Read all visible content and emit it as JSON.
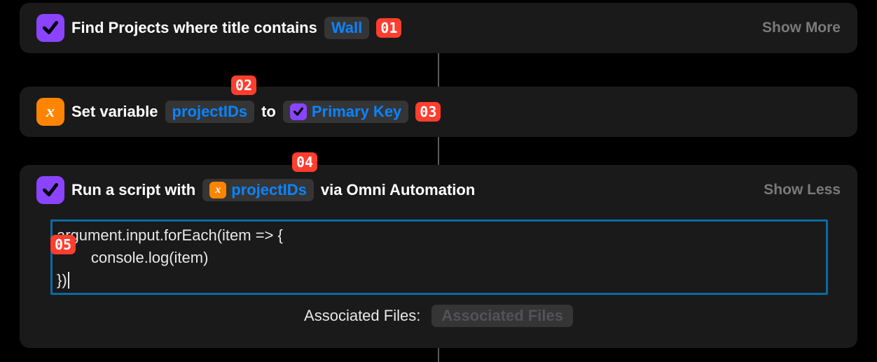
{
  "actions": {
    "find": {
      "text_before": "Find Projects where title contains",
      "search_token": "Wall",
      "show_more": "Show More"
    },
    "setvar": {
      "text_before": "Set variable",
      "var_token": "projectIDs",
      "text_mid": "to",
      "value_token": "Primary Key"
    },
    "script": {
      "text_before": "Run a script with",
      "var_token": "projectIDs",
      "text_after": "via Omni Automation",
      "show_less": "Show Less",
      "code_line1": "argument.input.forEach(item => {",
      "code_line2": "        console.log(item)",
      "code_line3": "})",
      "assoc_label": "Associated Files:",
      "assoc_placeholder": "Associated Files"
    }
  },
  "callouts": {
    "c1": "01",
    "c2": "02",
    "c3": "03",
    "c4": "04",
    "c5": "05"
  },
  "colors": {
    "card_bg": "#1a1a1a",
    "accent_purple": "#8a44ff",
    "accent_orange": "#ff8500",
    "token_bg": "#353535",
    "token_text": "#0a84ff",
    "callout_bg": "#ff3e2e",
    "code_border": "#0a6aa5"
  }
}
